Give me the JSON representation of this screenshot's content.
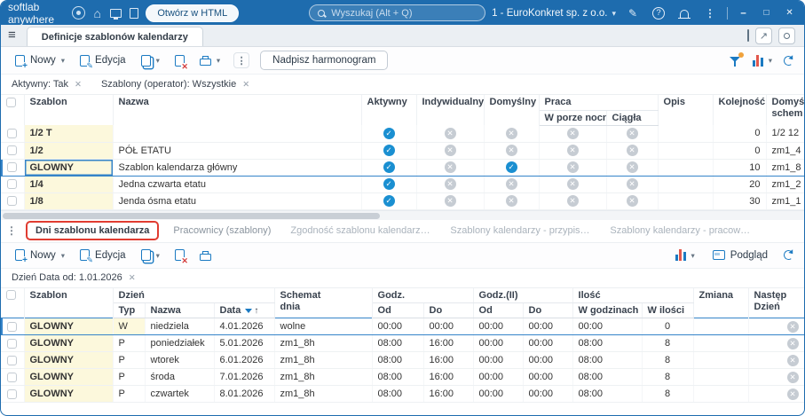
{
  "titlebar": {
    "app_name": "softlab anywhere",
    "open_html_button": "Otwórz w HTML",
    "search_placeholder": "Wyszukaj (Alt + Q)",
    "company": "1 - EuroKonkret sp. z o.o."
  },
  "tabbar": {
    "active_tab": "Definicje szablonów kalendarzy"
  },
  "upper_toolbar": {
    "new": "Nowy",
    "edit": "Edycja",
    "overwrite": "Nadpisz harmonogram"
  },
  "upper_filters": [
    "Aktywny: Tak",
    "Szablony (operator): Wszystkie"
  ],
  "upper_grid": {
    "headers": {
      "szablon": "Szablon",
      "nazwa": "Nazwa",
      "aktywny": "Aktywny",
      "indywidualny": "Indywidualny",
      "domyslny": "Domyślny",
      "praca": "Praca",
      "w_porze_nocnej": "W porze nocnej",
      "ciagla": "Ciągła",
      "opis": "Opis",
      "kolejnosc": "Kolejność",
      "domys_l1": "Domyś",
      "domys_l2": "schem"
    },
    "rows": [
      {
        "szablon": "1/2 T",
        "nazwa": "",
        "aktywny": "on",
        "indywidualny": "off",
        "domyslny": "off",
        "nocna": "off",
        "ciagla": "off",
        "opis": "",
        "kolejnosc": "0",
        "schemat": "1/2 12"
      },
      {
        "szablon": "1/2",
        "nazwa": "PÓŁ ETATU",
        "aktywny": "on",
        "indywidualny": "off",
        "domyslny": "off",
        "nocna": "off",
        "ciagla": "off",
        "opis": "",
        "kolejnosc": "0",
        "schemat": "zm1_4"
      },
      {
        "szablon": "GLOWNY",
        "nazwa": "Szablon kalendarza główny",
        "aktywny": "on",
        "indywidualny": "off",
        "domyslny": "on",
        "nocna": "off",
        "ciagla": "off",
        "opis": "",
        "kolejnosc": "10",
        "schemat": "zm1_8"
      },
      {
        "szablon": "1/4",
        "nazwa": "Jedna czwarta etatu",
        "aktywny": "on",
        "indywidualny": "off",
        "domyslny": "off",
        "nocna": "off",
        "ciagla": "off",
        "opis": "",
        "kolejnosc": "20",
        "schemat": "zm1_2"
      },
      {
        "szablon": "1/8",
        "nazwa": "Jenda ósma etatu",
        "aktywny": "on",
        "indywidualny": "off",
        "domyslny": "off",
        "nocna": "off",
        "ciagla": "off",
        "opis": "",
        "kolejnosc": "30",
        "schemat": "zm1_1"
      }
    ]
  },
  "lower_tabs": [
    "Dni szablonu kalendarza",
    "Pracownicy (szablony)",
    "Zgodność szablonu kalendarza z etatem",
    "Szablony kalendarzy - przypisania",
    "Szablony kalendarzy - pracownicy"
  ],
  "lower_toolbar": {
    "new": "Nowy",
    "edit": "Edycja",
    "preview": "Podgląd"
  },
  "lower_filters": [
    "Dzień Data od: 1.01.2026"
  ],
  "lower_grid": {
    "headers": {
      "szablon": "Szablon",
      "dzien": "Dzień",
      "typ": "Typ",
      "nazwa": "Nazwa",
      "data": "Data",
      "schemat_l1": "Schemat",
      "schemat_l2": "dnia",
      "godz": "Godz.",
      "godz2": "Godz.(II)",
      "od": "Od",
      "do": "Do",
      "ilosc": "Ilość",
      "w_godzinach": "W godzinach",
      "w_ilosci": "W ilości",
      "zmiana": "Zmiana",
      "nastep_l1": "Następ",
      "nastep_l2": "Dzień"
    },
    "rows": [
      {
        "szablon": "GLOWNY",
        "typ": "W",
        "nazwa": "niedziela",
        "data": "4.01.2026",
        "schemat": "wolne",
        "od1": "00:00",
        "do1": "00:00",
        "od2": "00:00",
        "do2": "00:00",
        "w_godzinach": "00:00",
        "w_ilosci": "0",
        "zmiana": "",
        "nastepny": "off"
      },
      {
        "szablon": "GLOWNY",
        "typ": "P",
        "nazwa": "poniedziałek",
        "data": "5.01.2026",
        "schemat": "zm1_8h",
        "od1": "08:00",
        "do1": "16:00",
        "od2": "00:00",
        "do2": "00:00",
        "w_godzinach": "08:00",
        "w_ilosci": "8",
        "zmiana": "",
        "nastepny": "off"
      },
      {
        "szablon": "GLOWNY",
        "typ": "P",
        "nazwa": "wtorek",
        "data": "6.01.2026",
        "schemat": "zm1_8h",
        "od1": "08:00",
        "do1": "16:00",
        "od2": "00:00",
        "do2": "00:00",
        "w_godzinach": "08:00",
        "w_ilosci": "8",
        "zmiana": "",
        "nastepny": "off"
      },
      {
        "szablon": "GLOWNY",
        "typ": "P",
        "nazwa": "środa",
        "data": "7.01.2026",
        "schemat": "zm1_8h",
        "od1": "08:00",
        "do1": "16:00",
        "od2": "00:00",
        "do2": "00:00",
        "w_godzinach": "08:00",
        "w_ilosci": "8",
        "zmiana": "",
        "nastepny": "off"
      },
      {
        "szablon": "GLOWNY",
        "typ": "P",
        "nazwa": "czwartek",
        "data": "8.01.2026",
        "schemat": "zm1_8h",
        "od1": "08:00",
        "do1": "16:00",
        "od2": "00:00",
        "do2": "00:00",
        "w_godzinach": "08:00",
        "w_ilosci": "8",
        "zmiana": "",
        "nastepny": "off"
      }
    ]
  }
}
